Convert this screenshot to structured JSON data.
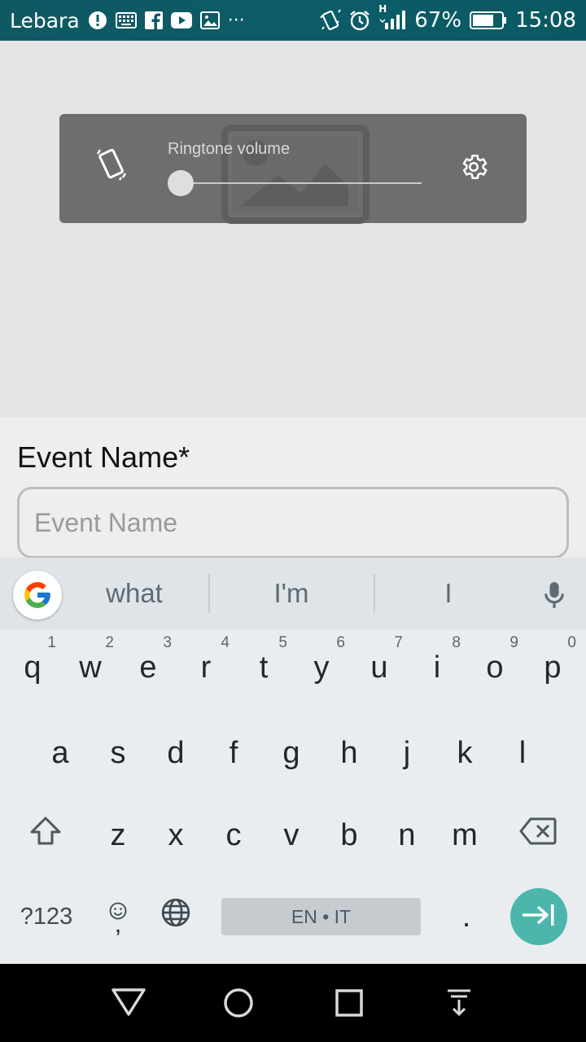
{
  "status_bar": {
    "carrier": "Lebara",
    "battery": "67%",
    "time": "15:08",
    "network": "H",
    "overflow": "···",
    "icons": [
      "alert-icon",
      "keyboard-icon",
      "facebook-icon",
      "youtube-icon",
      "image-icon",
      "vibrate-icon",
      "alarm-icon",
      "signal-icon",
      "battery-icon"
    ]
  },
  "volume_panel": {
    "label": "Ringtone volume",
    "level": 0
  },
  "form": {
    "event_name_label": "Event Name*",
    "event_name_placeholder": "Event Name",
    "event_name_value": ""
  },
  "keyboard": {
    "suggestions": [
      "what",
      "I'm",
      "I"
    ],
    "row1": [
      {
        "k": "q",
        "h": "1"
      },
      {
        "k": "w",
        "h": "2"
      },
      {
        "k": "e",
        "h": "3"
      },
      {
        "k": "r",
        "h": "4"
      },
      {
        "k": "t",
        "h": "5"
      },
      {
        "k": "y",
        "h": "6"
      },
      {
        "k": "u",
        "h": "7"
      },
      {
        "k": "i",
        "h": "8"
      },
      {
        "k": "o",
        "h": "9"
      },
      {
        "k": "p",
        "h": "0"
      }
    ],
    "row2": [
      "a",
      "s",
      "d",
      "f",
      "g",
      "h",
      "j",
      "k",
      "l"
    ],
    "row3": [
      "z",
      "x",
      "c",
      "v",
      "b",
      "n",
      "m"
    ],
    "symbols_label": "?123",
    "emoji_comma": ",",
    "space_label": "EN • IT",
    "period": ".",
    "accent_color": "#4db6ac"
  },
  "nav": {
    "buttons": [
      "back-icon",
      "home-icon",
      "recents-icon",
      "notifications-down-icon"
    ]
  }
}
